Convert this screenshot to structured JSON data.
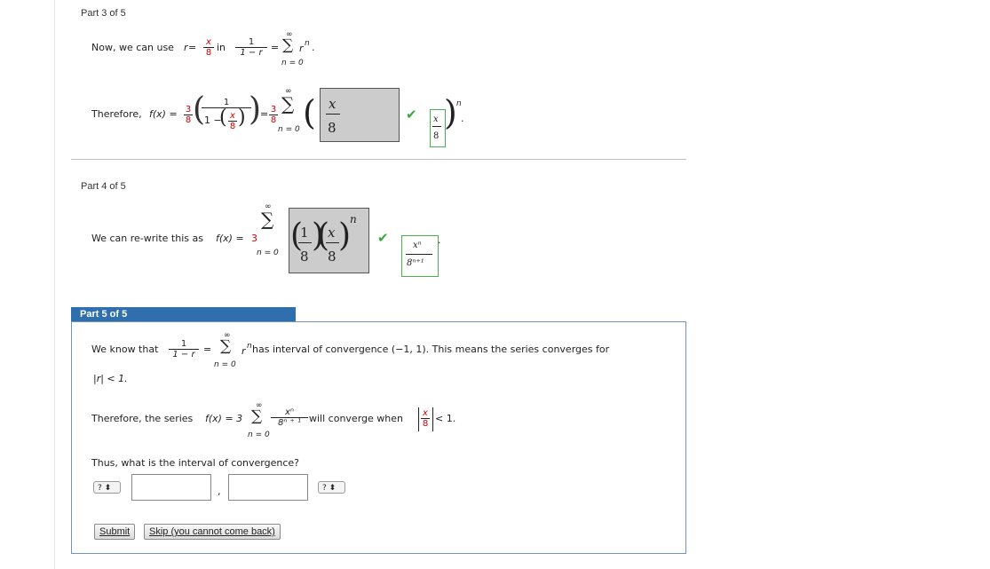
{
  "part3": {
    "label": "Part 3 of 5",
    "line1_prefix": "Now, we can use ",
    "r": "r",
    "eq": " = ",
    "x": "x",
    "eight": "8",
    "in": " in ",
    "one": "1",
    "one_minus_r": "1 − r",
    "inf": "∞",
    "sigma": "∑",
    "n_eq_0": "n = 0",
    "r_pow_n": "r",
    "n": "n",
    "period": ".",
    "line2_prefix": "Therefore, ",
    "fx": "f(x) = ",
    "three": "3",
    "one_minus": "1 −",
    "equals": "=",
    "answer_x": "x",
    "answer_8": "8",
    "correct_x": "x",
    "correct_8": "8"
  },
  "part4": {
    "label": "Part 4 of 5",
    "line_prefix": "We can re-write this as ",
    "fx": "f(x) = ",
    "three": "3",
    "inf": "∞",
    "sigma": "∑",
    "n_eq_0": "n = 0",
    "ans_1": "1",
    "ans_8a": "8",
    "ans_x": "x",
    "ans_8b": "8",
    "ans_n": "n",
    "correct_num": "xⁿ",
    "correct_den": "8ⁿ⁺¹",
    "period": "."
  },
  "part5": {
    "header": "Part 5 of 5",
    "line1_prefix": "We know that ",
    "one": "1",
    "one_minus_r": "1 − r",
    "eq": "=",
    "inf": "∞",
    "sigma": "∑",
    "n_eq_0": "n = 0",
    "r": "r",
    "n": "n",
    "line1_suffix": " has interval of convergence (−1, 1). This means the series converges for",
    "line2": "|r| < 1.",
    "line3_prefix": "Therefore, the series ",
    "fx": "f(x) = 3",
    "x_pow_n": "xⁿ",
    "den": "8ⁿ ⁺ ¹",
    "line3_mid": " will converge when ",
    "abs_x": "x",
    "abs_8": "8",
    "line3_suffix": " < 1.",
    "question": "Thus, what is the interval of convergence?",
    "select_left": "?  ⬍",
    "comma": ",",
    "select_right": "?  ⬍",
    "submit": "Submit",
    "skip": "Skip (you cannot come back)"
  }
}
